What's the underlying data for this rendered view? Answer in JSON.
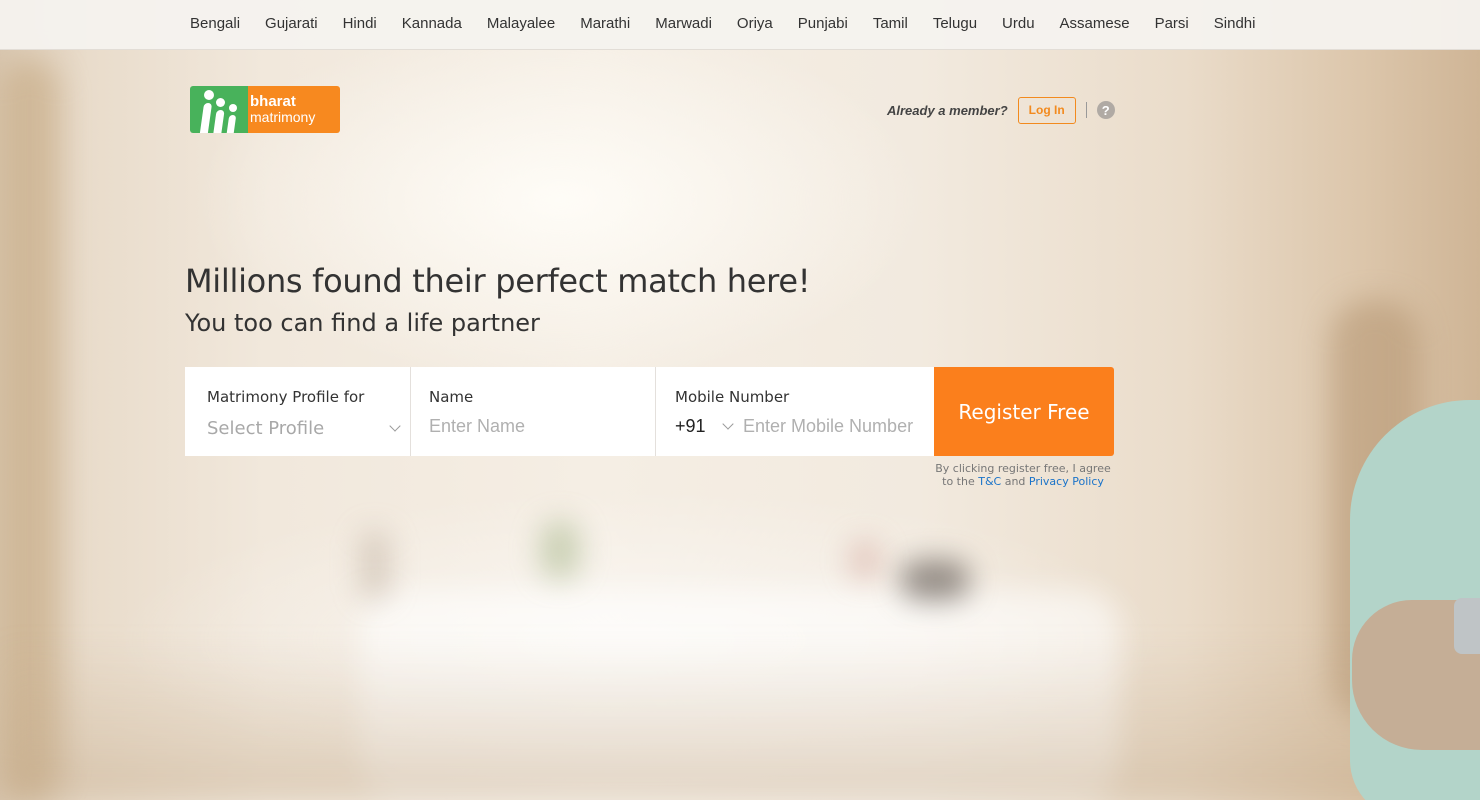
{
  "nav": {
    "languages": [
      "Bengali",
      "Gujarati",
      "Hindi",
      "Kannada",
      "Malayalee",
      "Marathi",
      "Marwadi",
      "Oriya",
      "Punjabi",
      "Tamil",
      "Telugu",
      "Urdu",
      "Assamese",
      "Parsi",
      "Sindhi"
    ]
  },
  "logo": {
    "line1": "bharat",
    "line2": "matrimony"
  },
  "header": {
    "member_prompt": "Already a member?",
    "login_label": "Log In",
    "help_symbol": "?"
  },
  "hero": {
    "headline": "Millions found their perfect match here!",
    "subheadline": "You too can find a life partner"
  },
  "form": {
    "profile_label": "Matrimony Profile for",
    "profile_value": "Select Profile",
    "name_label": "Name",
    "name_placeholder": "Enter Name",
    "mobile_label": "Mobile Number",
    "country_code": "+91",
    "mobile_placeholder": "Enter Mobile Number",
    "register_label": "Register Free"
  },
  "terms": {
    "prefix": "By clicking register free, I agree to the",
    "tc_link": "T&C",
    "and": "and",
    "privacy_link": "Privacy Policy"
  },
  "colors": {
    "accent_orange": "#fb7f1c",
    "logo_green": "#48b25b",
    "link_blue": "#1a73c9"
  },
  "icons": {
    "help": "help-icon",
    "profile_dropdown": "chevron-down-icon",
    "country_dropdown": "chevron-down-icon"
  }
}
